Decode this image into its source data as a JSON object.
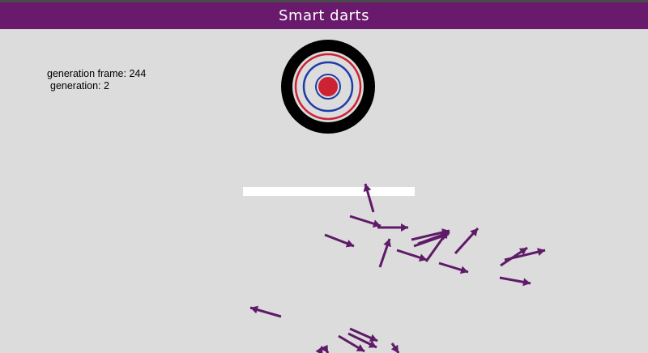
{
  "app": {
    "title": "Smart darts",
    "colors": {
      "header": "#6a1a6c",
      "background": "#dcdcdc",
      "dart": "#5f1a68",
      "target_outer": "#000000",
      "target_red": "#cc2233",
      "target_blue": "#1f3da8",
      "obstacle": "#ffffff"
    }
  },
  "stats": {
    "frame_label": "generation frame:",
    "frame_value": "244",
    "generation_label": "generation:",
    "generation_value": "2"
  },
  "darts_visible": 22
}
